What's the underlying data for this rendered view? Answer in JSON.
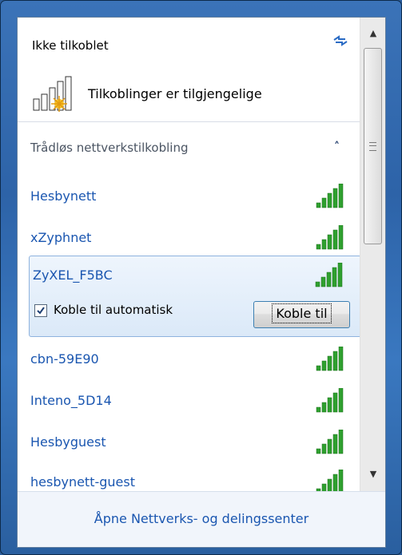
{
  "header": {
    "title": "Ikke tilkoblet",
    "status_text": "Tilkoblinger er tilgjengelige"
  },
  "section": {
    "title": "Trådløs nettverkstilkobling"
  },
  "networks": [
    {
      "name": "Hesbynett"
    },
    {
      "name": "xZyphnet"
    },
    {
      "name": "ZyXEL_F5BC"
    },
    {
      "name": "cbn-59E90"
    },
    {
      "name": "Inteno_5D14"
    },
    {
      "name": "Hesbyguest"
    },
    {
      "name": "hesbynett-guest"
    }
  ],
  "selected": {
    "auto_connect_label": "Koble til automatisk",
    "auto_connect_checked": true,
    "connect_button": "Koble til"
  },
  "footer": {
    "link": "Åpne Nettverks- og delingssenter"
  },
  "colors": {
    "link": "#1a56b0",
    "signal": "#2fa02f"
  }
}
